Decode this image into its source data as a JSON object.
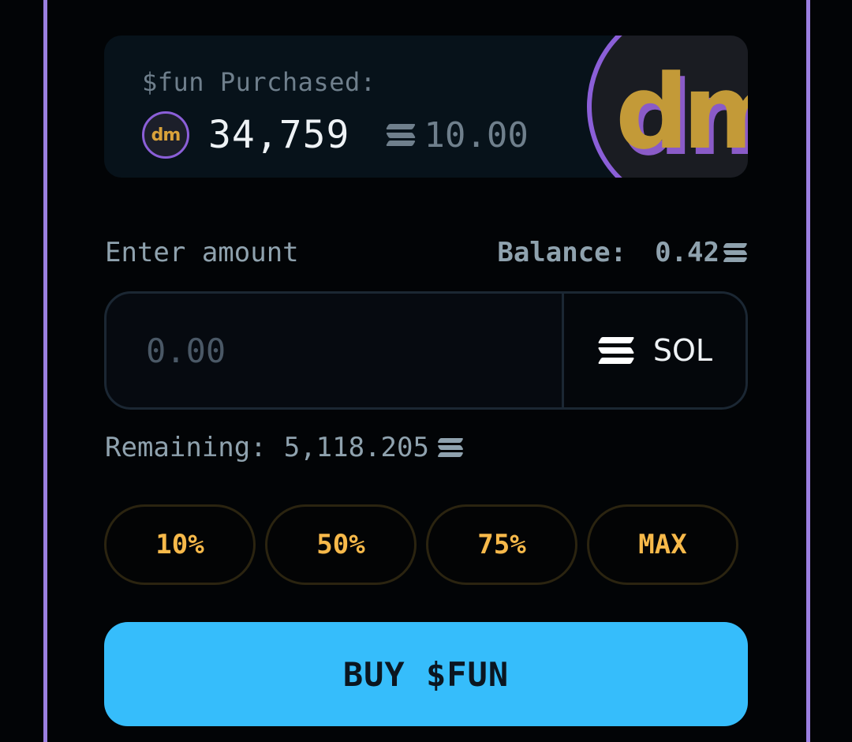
{
  "purchased": {
    "label": "$fun Purchased:",
    "avatar_text": "dm",
    "amount": "34,759",
    "sol_value": "10.00",
    "logo_text": "dm"
  },
  "amount": {
    "label": "Enter amount",
    "balance_label": "Balance:",
    "balance_value": "0.42",
    "placeholder": "0.00",
    "currency": "SOL"
  },
  "remaining": {
    "label": "Remaining:",
    "value": "5,118.205"
  },
  "percent_buttons": [
    "10%",
    "50%",
    "75%",
    "MAX"
  ],
  "buy_button": "BUY $FUN",
  "colors": {
    "accent_border": "#9b7fe0",
    "percent_text": "#f7b94a",
    "buy_bg": "#36bdfb"
  },
  "icons": [
    "solana-icon",
    "token-avatar",
    "token-logo"
  ]
}
